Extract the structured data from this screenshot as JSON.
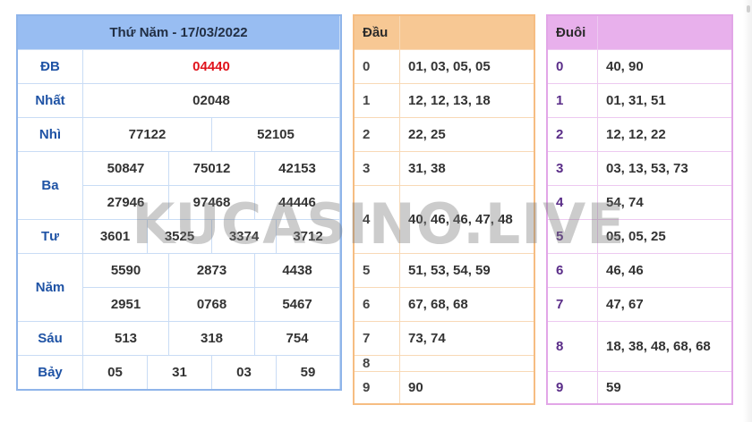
{
  "results": {
    "title": "Thứ Năm - 17/03/2022",
    "db_label": "ĐB",
    "db_value": "04440",
    "nhat_label": "Nhất",
    "nhat_value": "02048",
    "nhi_label": "Nhì",
    "nhi_values": [
      "77122",
      "52105"
    ],
    "ba_label": "Ba",
    "ba_values": [
      "50847",
      "75012",
      "42153",
      "27946",
      "97468",
      "44446"
    ],
    "tu_label": "Tư",
    "tu_values": [
      "3601",
      "3525",
      "3374",
      "3712"
    ],
    "nam_label": "Năm",
    "nam_values": [
      "5590",
      "2873",
      "4438",
      "2951",
      "0768",
      "5467"
    ],
    "sau_label": "Sáu",
    "sau_values": [
      "513",
      "318",
      "754"
    ],
    "bay_label": "Bảy",
    "bay_values": [
      "05",
      "31",
      "03",
      "59"
    ]
  },
  "dau": {
    "header": "Đầu",
    "rows": [
      {
        "digit": "0",
        "values": "01, 03, 05, 05"
      },
      {
        "digit": "1",
        "values": "12, 12, 13, 18"
      },
      {
        "digit": "2",
        "values": "22, 25"
      },
      {
        "digit": "3",
        "values": "31, 38"
      },
      {
        "digit": "4",
        "values": "40, 46, 46, 47, 48"
      },
      {
        "digit": "5",
        "values": "51, 53, 54, 59"
      },
      {
        "digit": "6",
        "values": "67, 68, 68"
      },
      {
        "digit": "7",
        "values": "73, 74"
      },
      {
        "digit": "8",
        "values": ""
      },
      {
        "digit": "9",
        "values": "90"
      }
    ]
  },
  "duoi": {
    "header": "Đuôi",
    "rows": [
      {
        "digit": "0",
        "values": "40, 90"
      },
      {
        "digit": "1",
        "values": "01, 31, 51"
      },
      {
        "digit": "2",
        "values": "12, 12, 22"
      },
      {
        "digit": "3",
        "values": "03, 13, 53, 73"
      },
      {
        "digit": "4",
        "values": "54, 74"
      },
      {
        "digit": "5",
        "values": "05, 05, 25"
      },
      {
        "digit": "6",
        "values": "46, 46"
      },
      {
        "digit": "7",
        "values": "47, 67"
      },
      {
        "digit": "8",
        "values": "18, 38, 48, 68, 68"
      },
      {
        "digit": "9",
        "values": "59"
      }
    ]
  },
  "watermark": "KUCASINO.LIVE",
  "colors": {
    "results_header": "#98bdf2",
    "results_label": "#1f53a5",
    "special_prize": "#e0131c",
    "dau_header": "#f7c894",
    "duoi_header": "#e8b0ec"
  }
}
